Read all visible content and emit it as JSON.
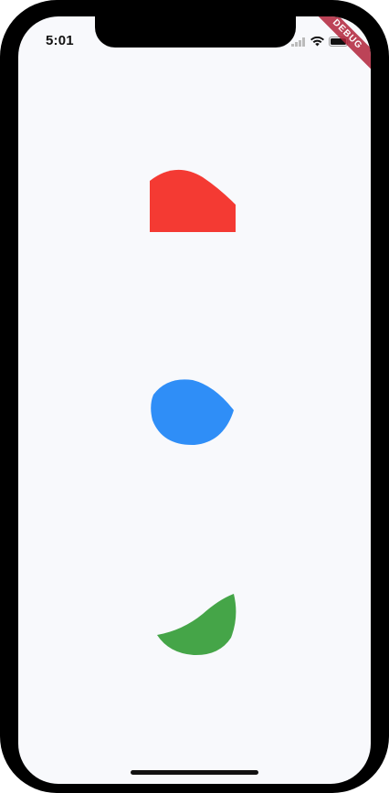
{
  "status_bar": {
    "time": "5:01"
  },
  "debug_banner": {
    "label": "DEBUG"
  },
  "shapes": [
    {
      "name": "red-morph-shape",
      "color": "#f43a33"
    },
    {
      "name": "blue-morph-shape",
      "color": "#2f8ef7"
    },
    {
      "name": "green-morph-shape",
      "color": "#45a548"
    }
  ],
  "colors": {
    "screen_background": "#f8f9fc",
    "device_frame": "#000000",
    "banner": "#b2243a"
  }
}
